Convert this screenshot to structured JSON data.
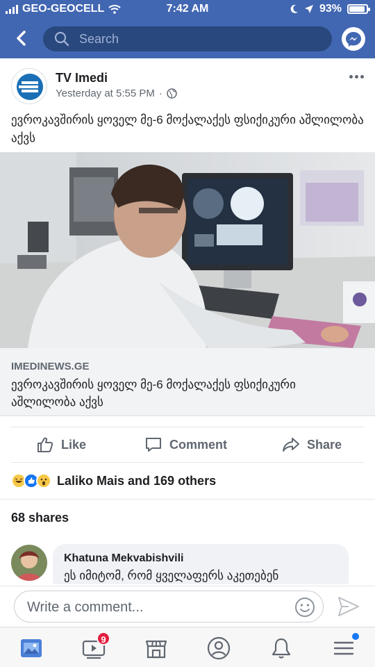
{
  "status_bar": {
    "carrier": "GEO-GEOCELL",
    "time": "7:42 AM",
    "battery": "93%",
    "battery_level": 0.93
  },
  "nav": {
    "search_placeholder": "Search"
  },
  "post": {
    "author": "TV Imedi",
    "timestamp": "Yesterday at 5:55 PM",
    "text": "ევროკავშირის ყოველ მე-6 მოქალაქეს ფსიქიკური აშლილობა აქვს",
    "link": {
      "domain": "IMEDINEWS.GE",
      "title": "ევროკავშირის ყოველ მე-6 მოქალაქეს ფსიქიკური აშლილობა აქვს"
    },
    "actions": {
      "like": "Like",
      "comment": "Comment",
      "share": "Share"
    },
    "reactions_text": "Laliko Mais and 169 others",
    "shares_text": "68 shares"
  },
  "comment": {
    "author": "Khatuna Mekvabishvili",
    "text": "ეს იმიტომ, რომ ყველაფერს აკეთებენ"
  },
  "composer": {
    "placeholder": "Write a comment..."
  },
  "tabbar": {
    "video_badge": "9"
  },
  "colors": {
    "brand": "#4267b2",
    "badge": "#e41e3f"
  }
}
